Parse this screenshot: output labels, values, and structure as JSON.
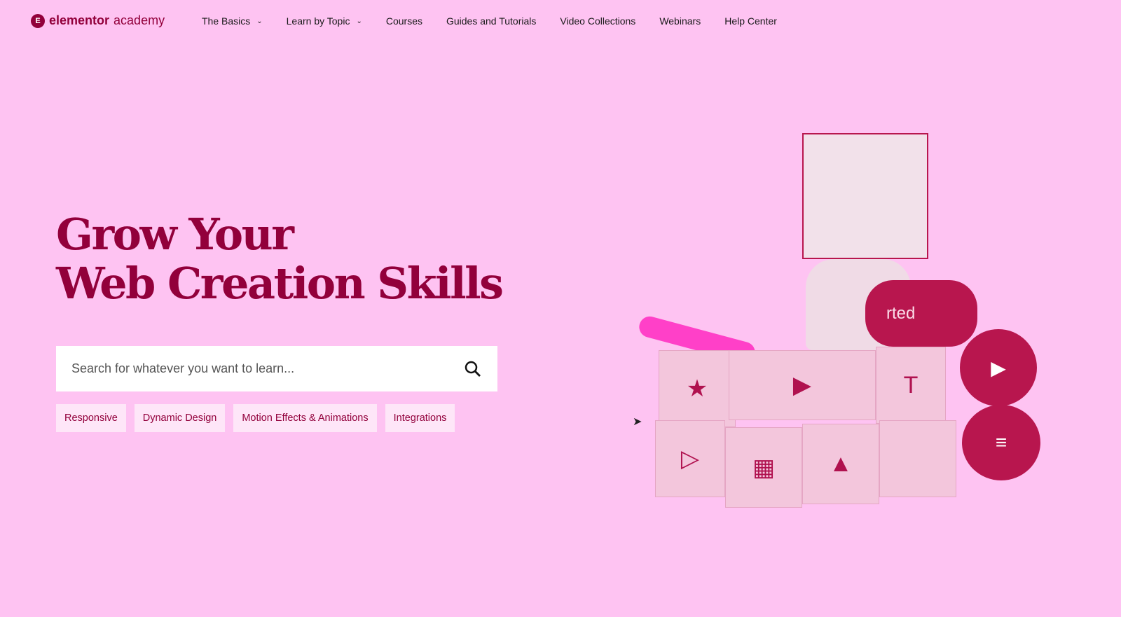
{
  "brand": {
    "mark": "E",
    "name_bold": "elementor",
    "name_light": "academy"
  },
  "nav": {
    "items": [
      {
        "label": "The Basics",
        "dropdown": true
      },
      {
        "label": "Learn by Topic",
        "dropdown": true
      },
      {
        "label": "Courses"
      },
      {
        "label": "Guides and Tutorials"
      },
      {
        "label": "Video Collections"
      },
      {
        "label": "Webinars"
      },
      {
        "label": "Help Center"
      }
    ]
  },
  "hero": {
    "title_line1": "Grow Your",
    "title_line2": "Web Creation Skills",
    "search_placeholder": "Search for whatever you want to learn...",
    "tags": [
      "Responsive",
      "Dynamic Design",
      "Motion Effects & Animations",
      "Integrations"
    ],
    "illustration_text": "rted",
    "block_glyph_t": "T"
  },
  "colors": {
    "background": "#fec3f2",
    "accent": "#92003b"
  }
}
